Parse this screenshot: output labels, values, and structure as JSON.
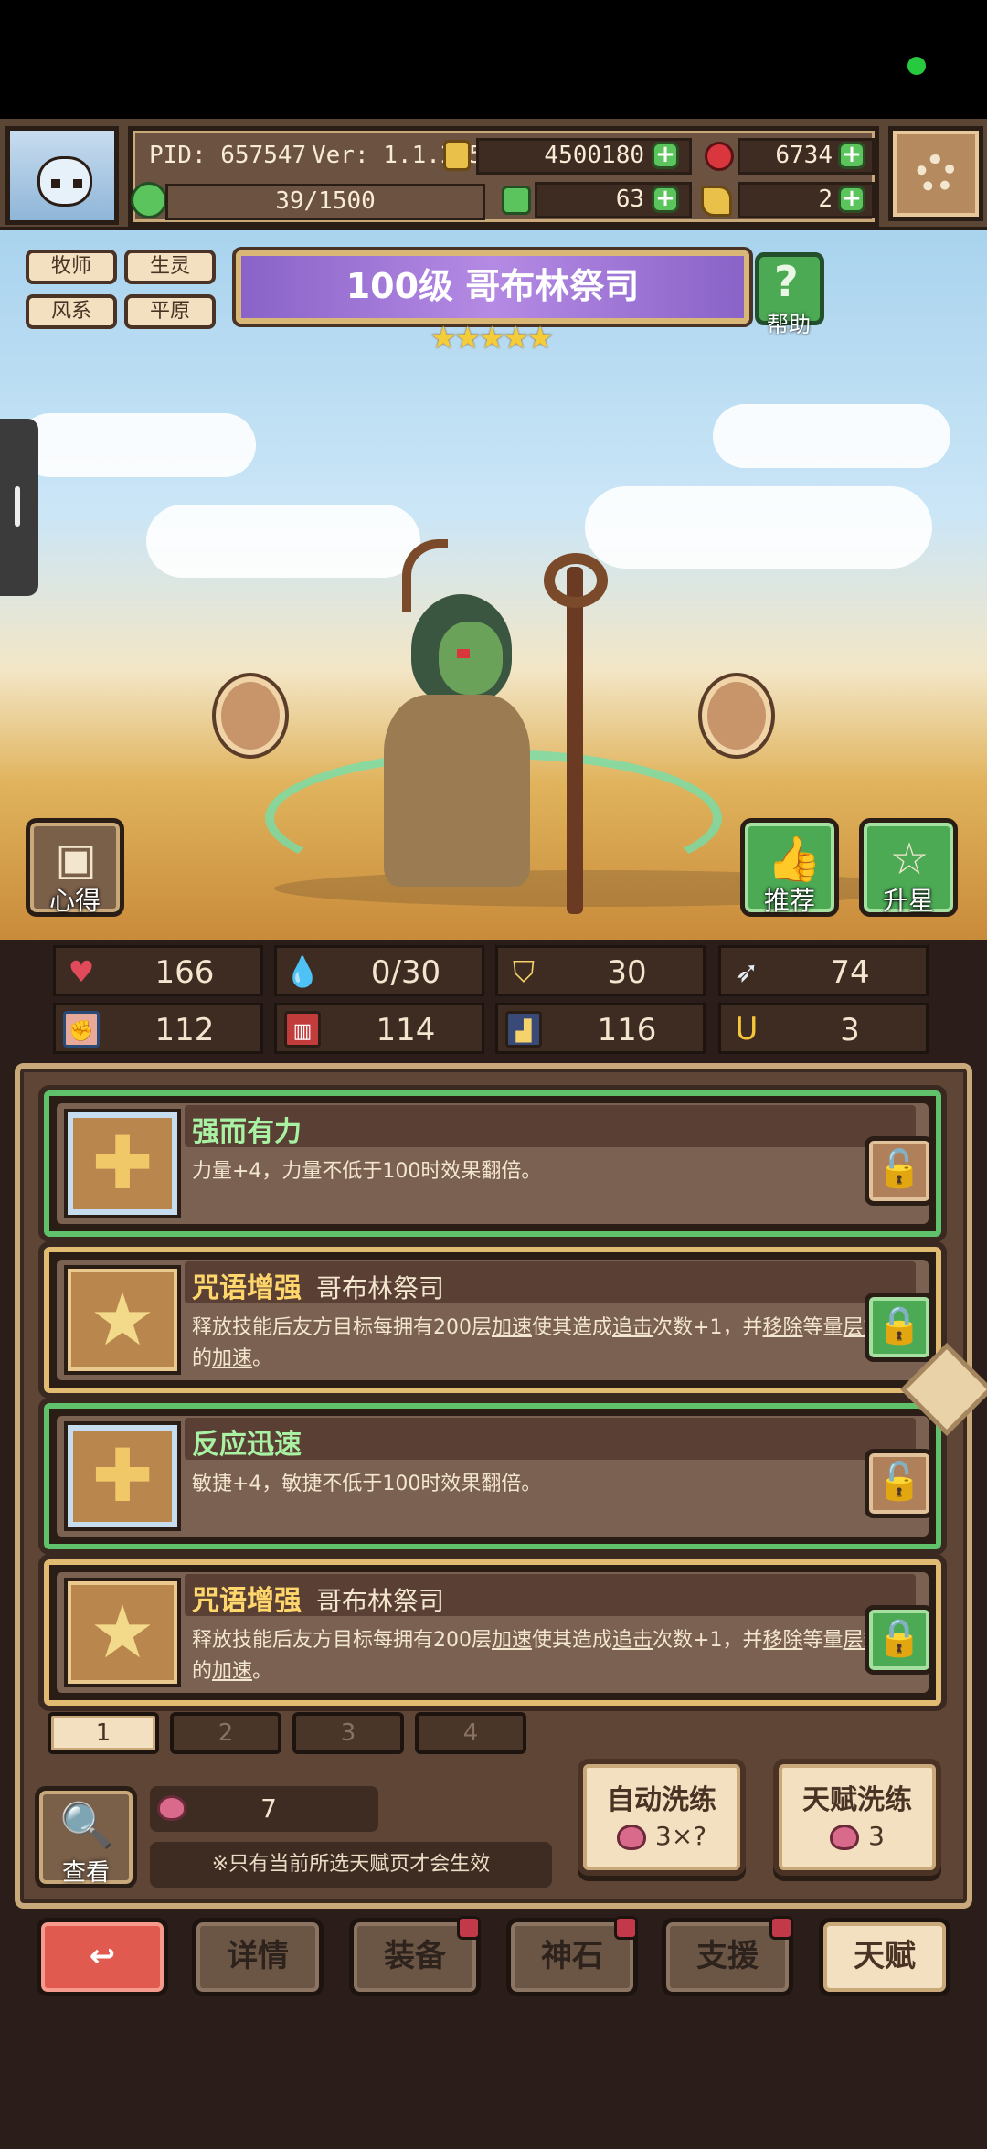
{
  "header": {
    "pid": "PID: 657547",
    "version": "Ver: 1.1.2.5",
    "exp": "39/1500",
    "gold": "4500180",
    "gems": "6734",
    "clover": "63",
    "keys": "2"
  },
  "hero": {
    "tags": [
      "牧师",
      "生灵",
      "风系",
      "平原"
    ],
    "title": "100级 哥布林祭司",
    "stars": "★★★★★",
    "help_label": "帮助"
  },
  "scene_buttons": {
    "xinde": "心得",
    "tuijian": "推荐",
    "shengxing": "升星"
  },
  "stats": {
    "hp": "166",
    "mana": "0/30",
    "defense": "30",
    "speed": "74",
    "strength": "112",
    "intellect": "114",
    "agility": "116",
    "luck": "3"
  },
  "talents": [
    {
      "title": "强而有力",
      "sub": "",
      "desc": "力量+4，力量不低于100时效果翻倍。"
    },
    {
      "title": "咒语增强",
      "sub": "哥布林祭司",
      "desc_parts": [
        "释放技能后友方目标每拥有200层",
        "加速",
        "使其造成",
        "追击",
        "次数+1，并",
        "移除",
        "等量",
        "层数",
        "的",
        "加速",
        "。"
      ]
    },
    {
      "title": "反应迅速",
      "sub": "",
      "desc": "敏捷+4，敏捷不低于100时效果翻倍。"
    },
    {
      "title": "咒语增强",
      "sub": "哥布林祭司",
      "desc_parts": [
        "释放技能后友方目标每拥有200层",
        "加速",
        "使其造成",
        "追击",
        "次数+1，并",
        "移除",
        "等量",
        "层数",
        "的",
        "加速",
        "。"
      ]
    }
  ],
  "pages": [
    "1",
    "2",
    "3",
    "4"
  ],
  "bottom": {
    "look_label": "查看",
    "potion_count": "7",
    "notice": "※只有当前所选天赋页才会生效",
    "auto_wash": {
      "title": "自动洗练",
      "cost": "3×?"
    },
    "talent_wash": {
      "title": "天赋洗练",
      "cost": "3"
    }
  },
  "nav": {
    "back": "↩",
    "details": "详情",
    "equipment": "装备",
    "godstone": "神石",
    "support": "支援",
    "talent": "天赋"
  },
  "colors": {
    "green_frame": "#5fc26a",
    "gold_frame": "#e1bb72",
    "title_purple": "#b48ae4"
  }
}
